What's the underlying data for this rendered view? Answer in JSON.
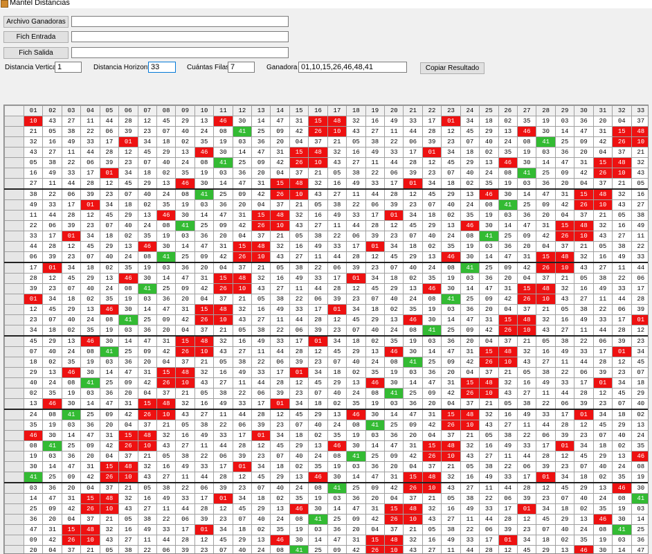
{
  "window": {
    "title": "Mantel Distancias"
  },
  "buttons": {
    "archivo": "Archivo Ganadoras",
    "entrada": "Fich Entrada",
    "salida": "Fich Salida",
    "copiar": "Copiar Resultado"
  },
  "fields": {
    "archivo": "",
    "entrada": "",
    "salida": "",
    "vertical_label": "Distancia Vertical",
    "vertical": "1",
    "horizontal_label": "Distancia Horizontal",
    "horizontal": "33",
    "filas_label": "Cuántas Filas",
    "filas": "7",
    "ganadora_label": "Ganadora",
    "ganadora": "01,10,15,26,46,48,41"
  },
  "highlight": {
    "red": [
      "01",
      "10",
      "15",
      "26",
      "46",
      "48"
    ],
    "green": [
      "41"
    ],
    "red_color": "#ee1111",
    "green_color": "#33bb33"
  },
  "grid": {
    "headers": [
      "01",
      "02",
      "03",
      "04",
      "05",
      "06",
      "07",
      "08",
      "09",
      "10",
      "11",
      "12",
      "13",
      "14",
      "15",
      "16",
      "17",
      "18",
      "19",
      "20",
      "21",
      "22",
      "23",
      "24",
      "25",
      "26",
      "27",
      "28",
      "29",
      "30",
      "31",
      "32",
      "33"
    ],
    "sequence": [
      "10",
      "43",
      "27",
      "11",
      "44",
      "28",
      "12",
      "45",
      "29",
      "13",
      "46",
      "30",
      "14",
      "47",
      "31",
      "15",
      "48",
      "32",
      "16",
      "49",
      "33",
      "17",
      "01",
      "34",
      "18",
      "02",
      "35",
      "19",
      "03",
      "36",
      "20",
      "04",
      "37",
      "21",
      "05",
      "38",
      "22",
      "06",
      "39",
      "23",
      "07",
      "40",
      "24",
      "08",
      "41",
      "25",
      "09",
      "42",
      "26"
    ],
    "block_size": 7,
    "rows_visible": 43
  }
}
